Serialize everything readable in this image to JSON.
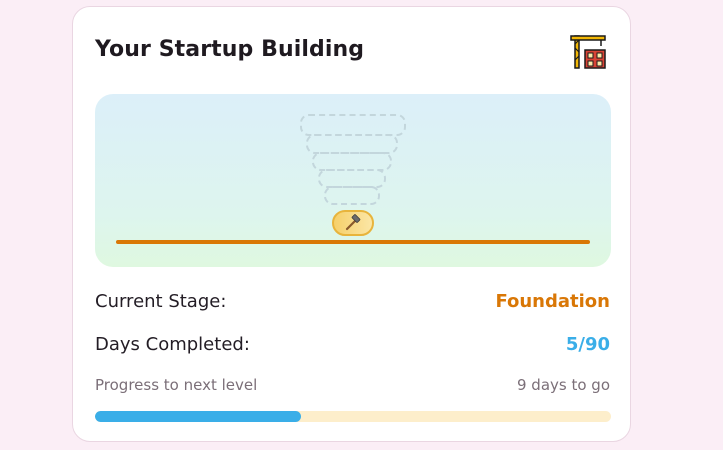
{
  "card": {
    "title": "Your Startup Building",
    "header_icon": "construction-crane-icon",
    "scene": {
      "stage_icon": "hammer-icon",
      "floors_planned": 5
    },
    "current_stage": {
      "label": "Current Stage:",
      "value": "Foundation",
      "color": "#d97706"
    },
    "days_completed": {
      "label": "Days Completed:",
      "value": "5/90",
      "color": "#3aaee8"
    },
    "progress": {
      "label": "Progress to next level",
      "remaining": "9 days to go",
      "fraction": 0.4,
      "fill_color": "#3aaee8",
      "track_color": "#fdeecb"
    }
  }
}
